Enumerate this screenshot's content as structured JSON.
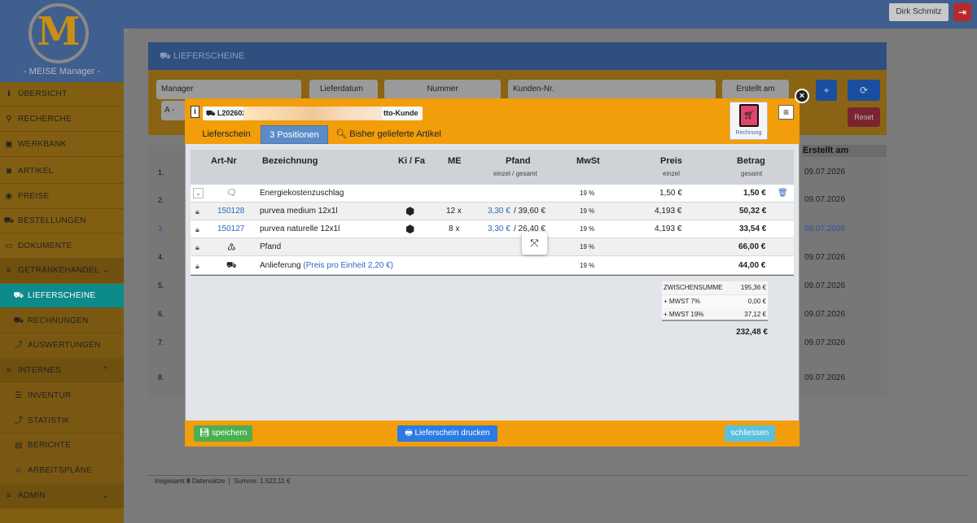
{
  "app": {
    "logo_letter": "M",
    "logo_text": "- MEISE Manager -",
    "user": "Dirk Schmitz",
    "logout_icon": "logout-icon"
  },
  "sidebar": [
    {
      "label": "ÜBERSICHT",
      "icon": "ℹ"
    },
    {
      "label": "RECHERCHE",
      "icon": "⚲"
    },
    {
      "label": "WERKBANK",
      "icon": "▣"
    },
    {
      "label": "ARTIKEL",
      "icon": "◙"
    },
    {
      "label": "PREISE",
      "icon": "◉"
    },
    {
      "label": "BESTELLUNGEN",
      "icon": "⛟"
    },
    {
      "label": "DOKUMENTE",
      "icon": "▭"
    },
    {
      "label": "GETRÄNKEHANDEL",
      "icon": "≡"
    },
    {
      "label": "LIEFERSCHEINE",
      "icon": "⛟"
    },
    {
      "label": "RECHNUNGEN",
      "icon": "⛟"
    },
    {
      "label": "AUSWERTUNGEN",
      "icon": "⤴"
    },
    {
      "label": "INTERNES",
      "icon": "≡"
    },
    {
      "label": "INVENTUR",
      "icon": "☰"
    },
    {
      "label": "STATISTIK",
      "icon": "⤴"
    },
    {
      "label": "BERICHTE",
      "icon": "▤"
    },
    {
      "label": "ARBEITSPLÄNE",
      "icon": "☺"
    },
    {
      "label": "ADMIN",
      "icon": "≡"
    }
  ],
  "page": {
    "title": "LIEFERSCHEINE",
    "filters": {
      "manager": "Manager",
      "manager_value": "A -",
      "lieferdatum": "Lieferdatum",
      "nummer": "Nummer",
      "kunden_nr": "Kunden-Nr.",
      "erstellt_am": "Erstellt am"
    },
    "reset": "Reset",
    "column_erstellt": "Erstellt am",
    "rows": [
      "1.",
      "2.",
      "3.",
      "4.",
      "5.",
      "6.",
      "7.",
      "8."
    ],
    "dates": [
      "09.07.2026",
      "09.07.2026",
      "09.07.2026",
      "09.07.2026",
      "09.07.2026",
      "09.07.2026",
      "09.07.2026",
      "09.07.2026"
    ],
    "footer": {
      "count_prefix": "Insgesamt",
      "count": "8",
      "count_suffix": "Datensätze",
      "sum": "Summe: 1.522,11 €"
    }
  },
  "modal": {
    "doc_number": "L202602",
    "doc_tail": "tto-Kunde",
    "tabs": [
      "Lieferschein",
      "3 Positionen",
      "Bisher gelieferte Artikel"
    ],
    "rechnung_label": "Rechnung",
    "columns": {
      "art_nr": "Art-Nr",
      "bezeichnung": "Bezeichnung",
      "ki_fa": "Ki / Fa",
      "me": "ME",
      "pfand": "Pfand",
      "pfand_sub": "einzel / gesamt",
      "mwst": "MwSt",
      "preis": "Preis",
      "preis_sub": "einzel",
      "betrag": "Betrag",
      "betrag_sub": "gesamt"
    },
    "positions": [
      {
        "art_nr": "",
        "bezeichnung": "Energiekostenzuschlag",
        "me": "",
        "pfand_einzel": "",
        "pfand_gesamt": "",
        "mwst": "19 %",
        "preis": "1,50 €",
        "betrag": "1,50 €"
      },
      {
        "art_nr": "150128",
        "bezeichnung": "purvea medium 12x1l",
        "me": "12 x",
        "pfand_einzel": "3,30 €",
        "pfand_gesamt": "/ 39,60 €",
        "mwst": "19 %",
        "preis": "4,193 €",
        "betrag": "50,32 €"
      },
      {
        "art_nr": "150127",
        "bezeichnung": "purvea naturelle 12x1l",
        "me": "8 x",
        "pfand_einzel": "3,30 €",
        "pfand_gesamt": "/ 26,40 €",
        "mwst": "19 %",
        "preis": "4,193 €",
        "betrag": "33,54 €"
      },
      {
        "art_nr": "",
        "bezeichnung": "Pfand",
        "me": "",
        "pfand_einzel": "",
        "pfand_gesamt": "",
        "mwst": "19 %",
        "preis": "",
        "betrag": "66,00 €"
      },
      {
        "art_nr": "",
        "bezeichnung": "Anlieferung",
        "bezeichnung_extra": "(Preis pro Einheit 2,20 €)",
        "me": "",
        "pfand_einzel": "",
        "pfand_gesamt": "",
        "mwst": "19 %",
        "preis": "",
        "betrag": "44,00 €"
      }
    ],
    "totals": {
      "zwischensumme_label": "ZWISCHENSUMME",
      "zwischensumme": "195,36 €",
      "mwst7_label": "+ MWST 7%",
      "mwst7": "0,00 €",
      "mwst19_label": "+ MWST 19%",
      "mwst19": "37,12 €",
      "total": "232,48 €"
    },
    "buttons": {
      "save": "speichern",
      "print": "Lieferschein drucken",
      "close": "schliessen"
    }
  }
}
